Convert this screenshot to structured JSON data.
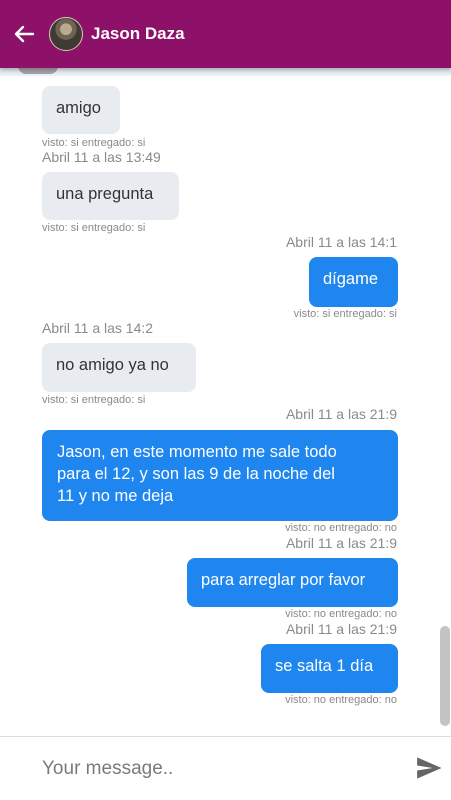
{
  "header": {
    "contact_name": "Jason Daza",
    "background_color": "#8e1169"
  },
  "messages": [
    {
      "direction": "in",
      "text": "amigo",
      "status": "visto: si entregado: si"
    },
    {
      "direction": "in",
      "time": "Abril 11 a las 13:49",
      "text": "una pregunta",
      "status": "visto: si entregado: si"
    },
    {
      "direction": "out",
      "time": "Abril 11 a las 14:1",
      "text": "dígame",
      "status": "visto: si entregado: si"
    },
    {
      "direction": "in",
      "time": "Abril 11 a las 14:2",
      "text": "no amigo ya no",
      "status": "visto: si entregado: si"
    },
    {
      "direction": "out",
      "time": "Abril 11 a las 21:9",
      "lines": [
        "Jason, en este momento me sale todo",
        "para el 12, y son las 9 de la noche del",
        "11 y no me deja"
      ],
      "status": "visto: no entregado: no"
    },
    {
      "direction": "out",
      "time": "Abril 11 a las 21:9",
      "text": "para arreglar por favor",
      "status": "visto: no entregado: no"
    },
    {
      "direction": "out",
      "time": "Abril 11 a las 21:9",
      "text": "se salta 1 día",
      "status": "visto: no entregado: no"
    }
  ],
  "composer": {
    "placeholder": "Your message..",
    "value": ""
  },
  "icons": {
    "back": "arrow-left-icon",
    "send": "send-icon",
    "avatar": "contact-avatar"
  },
  "colors": {
    "outgoing_bubble": "#1e86ee",
    "incoming_bubble": "#e8ecf1",
    "meta_text": "#8a8a8a"
  }
}
